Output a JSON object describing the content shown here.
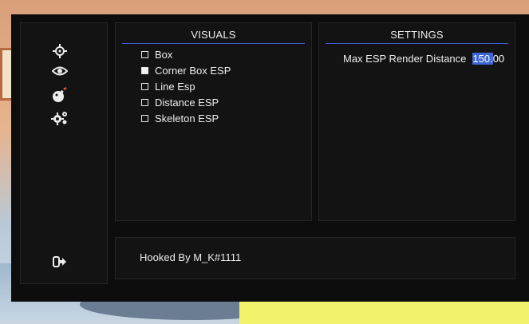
{
  "sidebar": {
    "items": [
      {
        "icon": "crosshair-icon"
      },
      {
        "icon": "eye-icon"
      },
      {
        "icon": "bomb-icon"
      },
      {
        "icon": "gears-icon"
      }
    ],
    "logout_icon": "logout-icon"
  },
  "visuals": {
    "title": "VISUALS",
    "options": [
      {
        "label": "Box",
        "checked": false
      },
      {
        "label": "Corner Box ESP",
        "checked": true
      },
      {
        "label": "Line Esp",
        "checked": false
      },
      {
        "label": "Distance ESP",
        "checked": false
      },
      {
        "label": "Skeleton ESP",
        "checked": false
      }
    ]
  },
  "settings": {
    "title": "SETTINGS",
    "render_distance": {
      "label": "Max ESP Render Distance",
      "value_selected": "150.",
      "value_rest": "00"
    }
  },
  "footer": {
    "text": "Hooked By M_K#1111"
  },
  "colors": {
    "panel_bg": "#0d0d0d",
    "box_bg": "#131313",
    "accent": "#3e5bd1",
    "text": "#eeeeee"
  }
}
